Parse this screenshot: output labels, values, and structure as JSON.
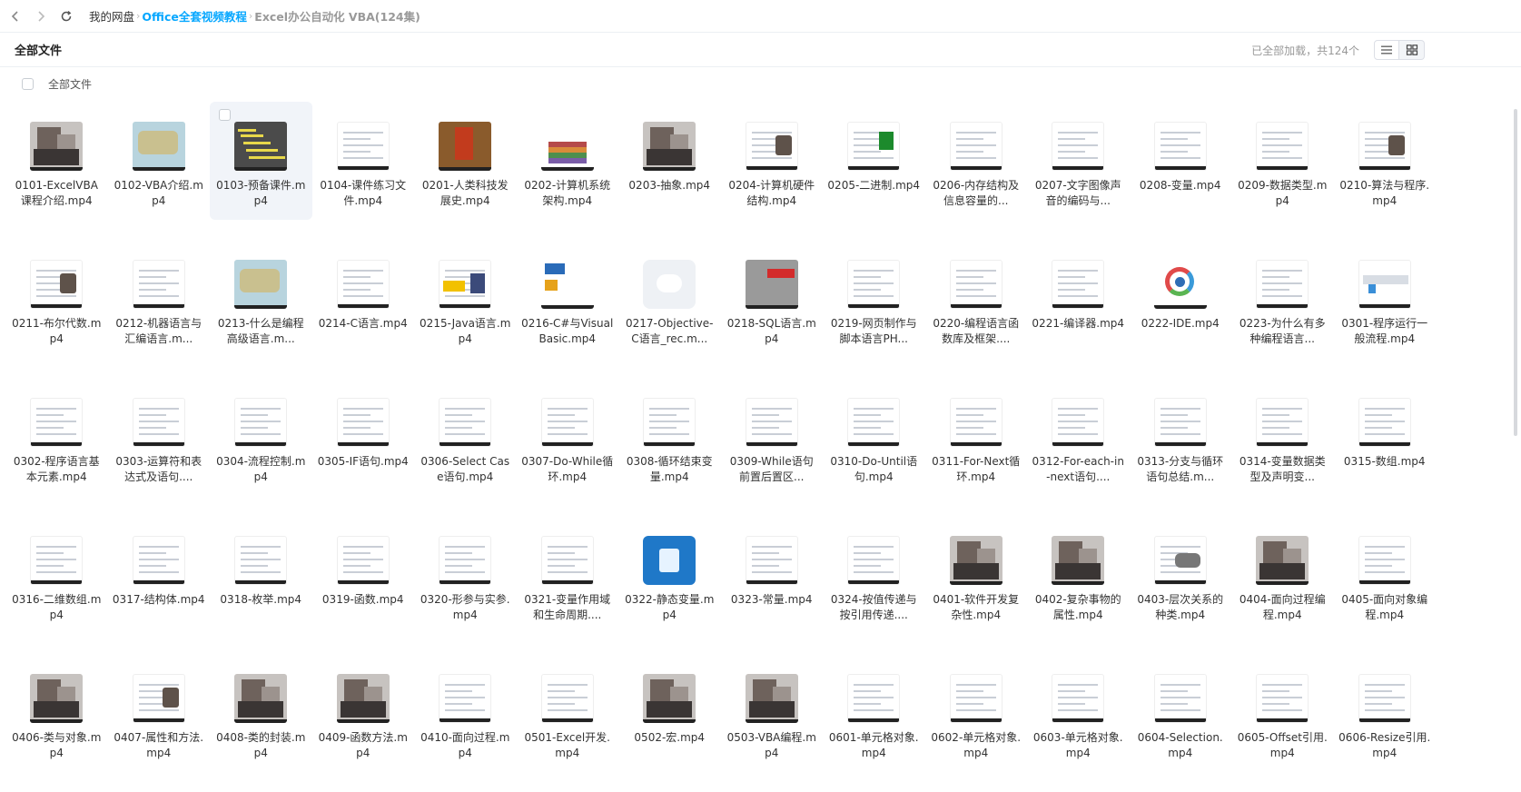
{
  "breadcrumb": [
    {
      "label": "我的网盘",
      "style": "root"
    },
    {
      "label": "Office全套视频教程",
      "style": "link"
    },
    {
      "label": "Excel办公自动化 VBA(124集)",
      "style": "current"
    }
  ],
  "header": {
    "title": "全部文件",
    "load_status": "已全部加载，共124个"
  },
  "select_bar": {
    "label": "全部文件"
  },
  "colors": {
    "link": "#06a7ff",
    "hover_bg": "#f1f4f9"
  },
  "files": [
    {
      "name": "0101-ExcelVBA课程介绍.mp4",
      "thumb": "face"
    },
    {
      "name": "0102-VBA介绍.mp4",
      "thumb": "map"
    },
    {
      "name": "0103-预备课件.mp4",
      "thumb": "dark",
      "hover": true
    },
    {
      "name": "0104-课件练习文件.mp4",
      "thumb": "doc"
    },
    {
      "name": "0201-人类科技发展史.mp4",
      "thumb": "photo"
    },
    {
      "name": "0202-计算机系统架构.mp4",
      "thumb": "bars"
    },
    {
      "name": "0203-抽象.mp4",
      "thumb": "face"
    },
    {
      "name": "0204-计算机硬件结构.mp4",
      "thumb": "portraitdoc"
    },
    {
      "name": "0205-二进制.mp4",
      "thumb": "greendoc"
    },
    {
      "name": "0206-内存结构及信息容量的...",
      "thumb": "doc"
    },
    {
      "name": "0207-文字图像声音的编码与...",
      "thumb": "doc"
    },
    {
      "name": "0208-变量.mp4",
      "thumb": "doc"
    },
    {
      "name": "0209-数据类型.mp4",
      "thumb": "doc"
    },
    {
      "name": "0210-算法与程序.mp4",
      "thumb": "portraitdoc"
    },
    {
      "name": "0211-布尔代数.mp4",
      "thumb": "portraitdoc"
    },
    {
      "name": "0212-机器语言与汇编语言.m...",
      "thumb": "doc"
    },
    {
      "name": "0213-什么是编程高级语言.m...",
      "thumb": "map"
    },
    {
      "name": "0214-C语言.mp4",
      "thumb": "doc"
    },
    {
      "name": "0215-Java语言.mp4",
      "thumb": "java"
    },
    {
      "name": "0216-C#与Visual Basic.mp4",
      "thumb": "sun"
    },
    {
      "name": "0217-Objective-C语言_rec.m...",
      "thumb": "cloud"
    },
    {
      "name": "0218-SQL语言.mp4",
      "thumb": "oracle"
    },
    {
      "name": "0219-网页制作与脚本语言PH...",
      "thumb": "doc"
    },
    {
      "name": "0220-编程语言函数库及框架....",
      "thumb": "doc"
    },
    {
      "name": "0221-编译器.mp4",
      "thumb": "doc"
    },
    {
      "name": "0222-IDE.mp4",
      "thumb": "ide"
    },
    {
      "name": "0223-为什么有多种编程语言...",
      "thumb": "doc"
    },
    {
      "name": "0301-程序运行一般流程.mp4",
      "thumb": "arrow"
    },
    {
      "name": "0302-程序语言基本元素.mp4",
      "thumb": "doc"
    },
    {
      "name": "0303-运算符和表达式及语句....",
      "thumb": "doc"
    },
    {
      "name": "0304-流程控制.mp4",
      "thumb": "doc"
    },
    {
      "name": "0305-IF语句.mp4",
      "thumb": "doc"
    },
    {
      "name": "0306-Select Case语句.mp4",
      "thumb": "doc"
    },
    {
      "name": "0307-Do-While循环.mp4",
      "thumb": "doc"
    },
    {
      "name": "0308-循环结束变量.mp4",
      "thumb": "doc"
    },
    {
      "name": "0309-While语句前置后置区...",
      "thumb": "doc"
    },
    {
      "name": "0310-Do-Until语句.mp4",
      "thumb": "doc"
    },
    {
      "name": "0311-For-Next循环.mp4",
      "thumb": "doc"
    },
    {
      "name": "0312-For-each-in-next语句....",
      "thumb": "doc"
    },
    {
      "name": "0313-分支与循环语句总结.m...",
      "thumb": "doc"
    },
    {
      "name": "0314-变量数据类型及声明变...",
      "thumb": "doc"
    },
    {
      "name": "0315-数组.mp4",
      "thumb": "doc"
    },
    {
      "name": "0316-二维数组.mp4",
      "thumb": "doc"
    },
    {
      "name": "0317-结构体.mp4",
      "thumb": "doc"
    },
    {
      "name": "0318-枚举.mp4",
      "thumb": "doc"
    },
    {
      "name": "0319-函数.mp4",
      "thumb": "doc"
    },
    {
      "name": "0320-形参与实参.mp4",
      "thumb": "doc"
    },
    {
      "name": "0321-变量作用域和生命周期....",
      "thumb": "doc"
    },
    {
      "name": "0322-静态变量.mp4",
      "thumb": "blue"
    },
    {
      "name": "0323-常量.mp4",
      "thumb": "doc"
    },
    {
      "name": "0324-按值传递与按引用传递....",
      "thumb": "doc"
    },
    {
      "name": "0401-软件开发复杂性.mp4",
      "thumb": "face"
    },
    {
      "name": "0402-复杂事物的属性.mp4",
      "thumb": "face"
    },
    {
      "name": "0403-层次关系的种类.mp4",
      "thumb": "car"
    },
    {
      "name": "0404-面向过程编程.mp4",
      "thumb": "face"
    },
    {
      "name": "0405-面向对象编程.mp4",
      "thumb": "doc"
    },
    {
      "name": "0406-类与对象.mp4",
      "thumb": "face"
    },
    {
      "name": "0407-属性和方法.mp4",
      "thumb": "portraitdoc"
    },
    {
      "name": "0408-类的封装.mp4",
      "thumb": "face"
    },
    {
      "name": "0409-函数方法.mp4",
      "thumb": "face"
    },
    {
      "name": "0410-面向过程.mp4",
      "thumb": "doc"
    },
    {
      "name": "0501-Excel开发.mp4",
      "thumb": "doc"
    },
    {
      "name": "0502-宏.mp4",
      "thumb": "face"
    },
    {
      "name": "0503-VBA编程.mp4",
      "thumb": "face"
    },
    {
      "name": "0601-单元格对象.mp4",
      "thumb": "doc"
    },
    {
      "name": "0602-单元格对象.mp4",
      "thumb": "doc"
    },
    {
      "name": "0603-单元格对象.mp4",
      "thumb": "doc"
    },
    {
      "name": "0604-Selection.mp4",
      "thumb": "doc"
    },
    {
      "name": "0605-Offset引用.mp4",
      "thumb": "doc"
    },
    {
      "name": "0606-Resize引用.mp4",
      "thumb": "doc"
    }
  ]
}
